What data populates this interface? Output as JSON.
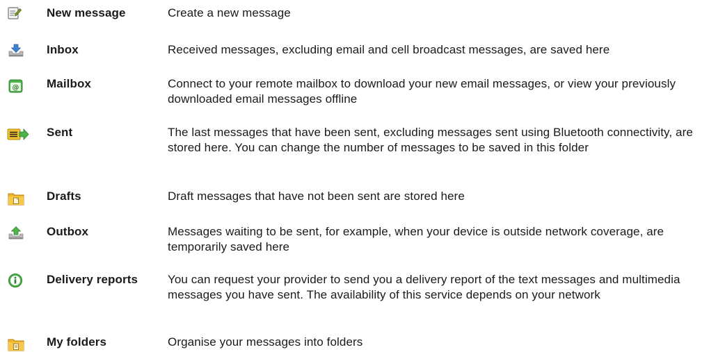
{
  "items": [
    {
      "icon": "new-message-icon",
      "title": "New message",
      "description": "Create a new message"
    },
    {
      "icon": "inbox-icon",
      "title": "Inbox",
      "description": "Received messages, excluding email and cell broadcast messages, are saved here"
    },
    {
      "icon": "mailbox-icon",
      "title": "Mailbox",
      "description": "Connect to your remote mailbox to download your new email messages, or view your previously downloaded email messages offline"
    },
    {
      "icon": "sent-icon",
      "title": "Sent",
      "description": "The last messages that have been sent, excluding messages sent using Bluetooth connectivity, are stored here. You can change the number of messages to be saved in this folder"
    },
    {
      "icon": "drafts-folder-icon",
      "title": "Drafts",
      "description": "Draft messages that have not been sent are stored here"
    },
    {
      "icon": "outbox-icon",
      "title": "Outbox",
      "description": "Messages waiting to be sent, for example, when your device is outside network coverage, are temporarily saved here"
    },
    {
      "icon": "info-icon",
      "title": "Delivery reports",
      "description": "You can request your provider to send you a delivery report of the text messages and multimedia messages you have sent. The availability of this service depends on your network"
    },
    {
      "icon": "my-folders-icon",
      "title": "My folders",
      "description": "Organise your messages into folders"
    }
  ]
}
